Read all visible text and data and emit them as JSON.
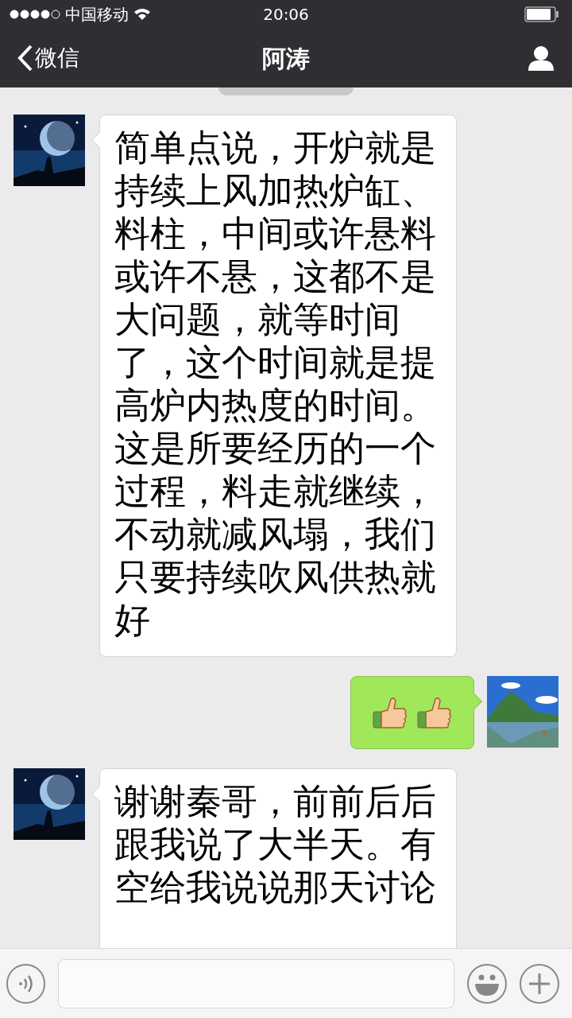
{
  "status_bar": {
    "carrier": "中国移动",
    "time": "20:06"
  },
  "nav": {
    "back": "微信",
    "title": "阿涛"
  },
  "messages": [
    {
      "outgoing": false,
      "kind": "text",
      "text": "简单点说，开炉就是持续上风加热炉缸、料柱，中间或许悬料或许不悬，这都不是大问题，就等时间了，这个时间就是提高炉内热度的时间。这是所要经历的一个过程，料走就继续，不动就减风塌，我们只要持续吹风供热就好"
    },
    {
      "outgoing": true,
      "kind": "thumbs"
    },
    {
      "outgoing": false,
      "kind": "text",
      "text": "谢谢秦哥，前前后后跟我说了大半天。有空给我说说那天讨论"
    }
  ]
}
